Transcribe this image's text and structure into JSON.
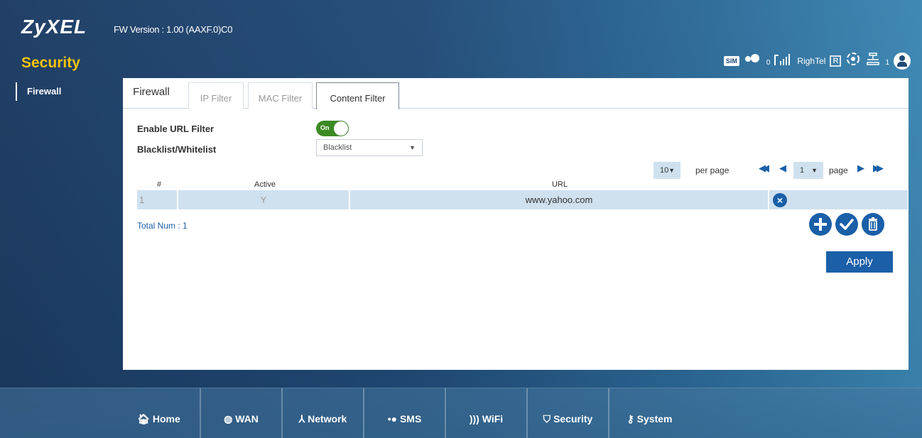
{
  "header": {
    "logo": "ZyXEL",
    "fw_version": "FW Version : 1.00 (AAXF.0)C0",
    "section_title": "Security"
  },
  "status": {
    "sim_label": "SIM",
    "sms_count": "0",
    "operator": "RighTel",
    "roaming_label": "R",
    "clients_count": "1"
  },
  "sidebar": {
    "items": [
      {
        "label": "Firewall"
      }
    ]
  },
  "tabs": {
    "group_label": "Firewall",
    "items": [
      {
        "label": "IP Filter"
      },
      {
        "label": "MAC Filter"
      },
      {
        "label": "Content Filter",
        "active": true
      }
    ]
  },
  "form": {
    "url_filter_label": "Enable URL Filter",
    "url_filter_state": "On",
    "list_type_label": "Blacklist/Whitelist",
    "list_type_value": "Blacklist"
  },
  "pager": {
    "per_page_value": "10",
    "per_page_label": "per page",
    "page_value": "1",
    "page_label": "page"
  },
  "table": {
    "headers": [
      "#",
      "Active",
      "URL"
    ],
    "rows": [
      {
        "num": "1",
        "active": "Y",
        "url": "www.yahoo.com"
      }
    ],
    "total": "Total Num : 1"
  },
  "actions": {
    "apply_label": "Apply"
  },
  "nav": {
    "items": [
      {
        "label": "Home"
      },
      {
        "label": "WAN"
      },
      {
        "label": "Network"
      },
      {
        "label": "SMS"
      },
      {
        "label": "WiFi"
      },
      {
        "label": "Security"
      },
      {
        "label": "System"
      }
    ]
  },
  "colors": {
    "accent": "#1a5fa8",
    "section_title": "#f5c400",
    "toggle_on": "#3b8a24",
    "row_bg": "#cfe1ef"
  }
}
